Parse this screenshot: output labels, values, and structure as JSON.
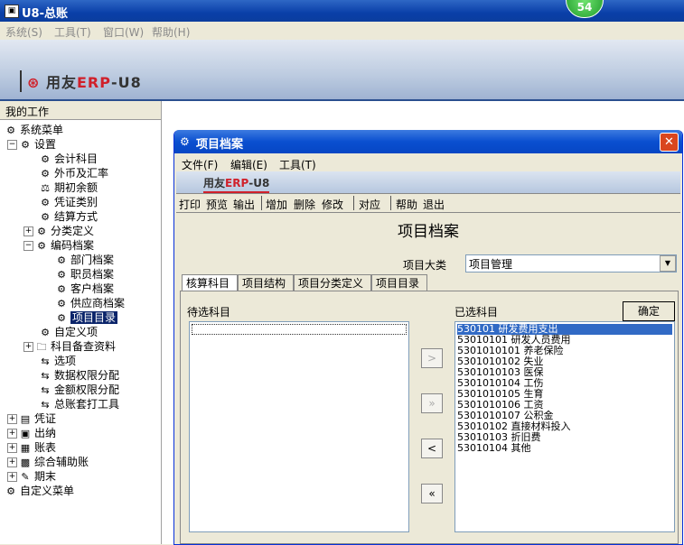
{
  "app": {
    "title": "U8-总账",
    "badge": "54"
  },
  "menubar": [
    "系统(S)",
    "工具(T)",
    "窗口(W)",
    "帮助(H)"
  ],
  "banner": {
    "logo_prefix": "用友",
    "logo_erp": "ERP",
    "logo_suffix": "-U8"
  },
  "left_panel": {
    "header": "我的工作",
    "tree": [
      {
        "label": "系统菜单"
      },
      {
        "label": "设置"
      },
      {
        "label": "会计科目"
      },
      {
        "label": "外币及汇率"
      },
      {
        "label": "期初余额"
      },
      {
        "label": "凭证类别"
      },
      {
        "label": "结算方式"
      },
      {
        "label": "分类定义"
      },
      {
        "label": "编码档案"
      },
      {
        "label": "部门档案"
      },
      {
        "label": "职员档案"
      },
      {
        "label": "客户档案"
      },
      {
        "label": "供应商档案"
      },
      {
        "label": "项目目录"
      },
      {
        "label": "自定义项"
      },
      {
        "label": "科目备查资料"
      },
      {
        "label": "选项"
      },
      {
        "label": "数据权限分配"
      },
      {
        "label": "金额权限分配"
      },
      {
        "label": "总账套打工具"
      },
      {
        "label": "凭证"
      },
      {
        "label": "出纳"
      },
      {
        "label": "账表"
      },
      {
        "label": "综合辅助账"
      },
      {
        "label": "期末"
      },
      {
        "label": "自定义菜单"
      }
    ]
  },
  "dialog": {
    "title": "项目档案",
    "close": "✕",
    "menu": [
      "文件(F)",
      "编辑(E)",
      "工具(T)"
    ],
    "logo_prefix": "用友",
    "logo_erp": "ERP",
    "logo_suffix": "-U8",
    "toolbar": [
      "打印",
      "预览",
      "输出",
      "增加",
      "删除",
      "修改",
      "对应",
      "帮助",
      "退出"
    ],
    "form_title": "项目档案",
    "category_label": "项目大类",
    "category_value": "项目管理",
    "tabs": [
      "核算科目",
      "项目结构",
      "项目分类定义",
      "项目目录"
    ],
    "pending_label": "待选科目",
    "selected_label": "已选科目",
    "ok_button": "确定",
    "move_buttons": [
      ">",
      "»",
      "<",
      "«"
    ],
    "selected_items": [
      "530101  研发费用支出",
      "53010101  研发人员费用",
      "5301010101  养老保险",
      "5301010102  失业",
      "5301010103  医保",
      "5301010104  工伤",
      "5301010105  生育",
      "5301010106  工资",
      "5301010107  公积金",
      "53010102  直接材料投入",
      "53010103  折旧费",
      "53010104  其他"
    ]
  }
}
